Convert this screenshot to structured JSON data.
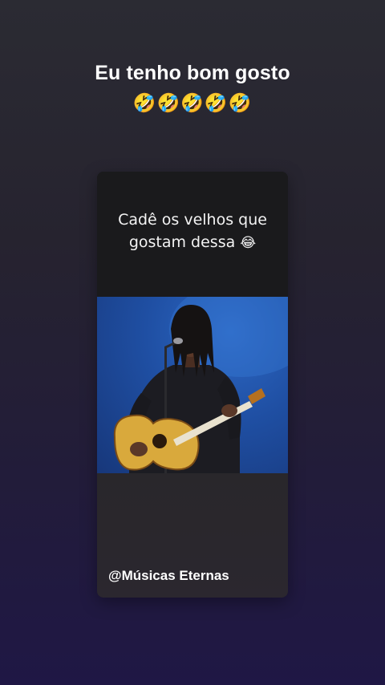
{
  "story": {
    "caption_title": "Eu tenho bom gosto",
    "caption_emojis": "🤣🤣🤣🤣🤣"
  },
  "post": {
    "text_line1": "Cadê os velhos que",
    "text_line2": "gostam dessa",
    "text_emoji": "😂",
    "watermark": "@Músicas Eternas"
  }
}
